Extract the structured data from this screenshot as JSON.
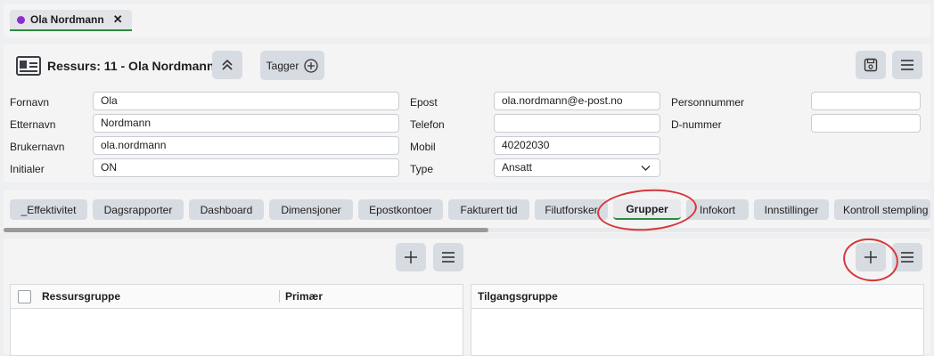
{
  "top_tab": {
    "label": "Ola Nordmann",
    "close": "✕"
  },
  "header": {
    "title": "Ressurs: 11 - Ola Nordmann",
    "tagger_label": "Tagger"
  },
  "form": {
    "fornavn": {
      "label": "Fornavn",
      "value": "Ola"
    },
    "etternavn": {
      "label": "Etternavn",
      "value": "Nordmann"
    },
    "brukernavn": {
      "label": "Brukernavn",
      "value": "ola.nordmann"
    },
    "initialer": {
      "label": "Initialer",
      "value": "ON"
    },
    "epost": {
      "label": "Epost",
      "value": "ola.nordmann@e-post.no"
    },
    "telefon": {
      "label": "Telefon",
      "value": ""
    },
    "mobil": {
      "label": "Mobil",
      "value": "40202030"
    },
    "type": {
      "label": "Type",
      "value": "Ansatt"
    },
    "personnummer": {
      "label": "Personnummer",
      "value": ""
    },
    "dnummer": {
      "label": "D-nummer",
      "value": ""
    }
  },
  "tabs": [
    {
      "label": "_Effektivitet"
    },
    {
      "label": "Dagsrapporter"
    },
    {
      "label": "Dashboard"
    },
    {
      "label": "Dimensjoner"
    },
    {
      "label": "Epostkontoer"
    },
    {
      "label": "Fakturert tid"
    },
    {
      "label": "Filutforsker"
    },
    {
      "label": "Grupper",
      "active": true
    },
    {
      "label": "Infokort"
    },
    {
      "label": "Innstillinger"
    },
    {
      "label": "Kontroll stempling"
    }
  ],
  "left_grid": {
    "col1": "Ressursgruppe",
    "col2": "Primær"
  },
  "right_grid": {
    "col1": "Tilgangsgruppe"
  },
  "colors": {
    "accent_green": "#2f8a3e",
    "chip_dot": "#8d2ed1",
    "annotation_red": "#d6383a"
  },
  "icons": [
    "id-card-icon",
    "chevron-double-up-icon",
    "plus-circle-icon",
    "save-icon",
    "menu-icon",
    "plus-icon",
    "chevron-down-icon"
  ]
}
